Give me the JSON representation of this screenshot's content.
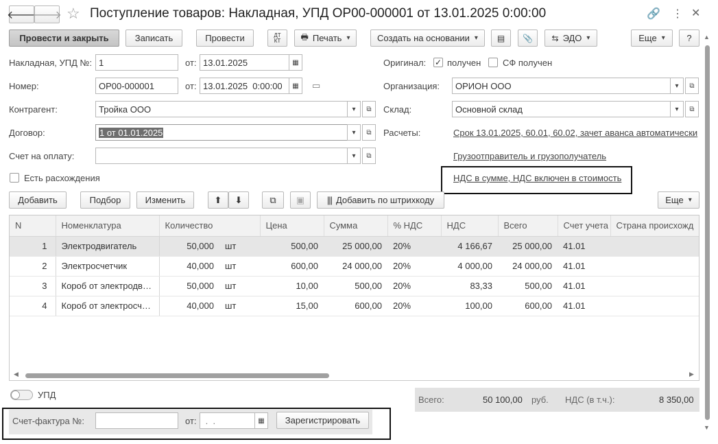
{
  "window": {
    "title": "Поступление товаров: Накладная, УПД ОР00-000001 от 13.01.2025 0:00:00"
  },
  "toolbar": {
    "post_close": "Провести и закрыть",
    "write": "Записать",
    "post": "Провести",
    "dt_kt_top": "ДТ",
    "dt_kt_bottom": "КТ",
    "print": "Печать",
    "create_based": "Создать на основании",
    "edo": "ЭДО",
    "more": "Еще",
    "help": "?"
  },
  "form": {
    "invoice_label": "Накладная, УПД №:",
    "invoice_no": "1",
    "from_label": "от:",
    "invoice_date": "13.01.2025",
    "number_label": "Номер:",
    "number_value": "ОР00-000001",
    "number_date": "13.01.2025  0:00:00",
    "contractor_label": "Контрагент:",
    "contractor_value": "Тройка ООО",
    "contract_label": "Договор:",
    "contract_value": "1 от 01.01.2025",
    "payment_label": "Счет на оплату:",
    "payment_value": "",
    "discrepancy_label": "Есть расхождения",
    "original_label": "Оригинал:",
    "received_label": "получен",
    "sf_received_label": "СФ получен",
    "org_label": "Организация:",
    "org_value": "ОРИОН ООО",
    "warehouse_label": "Склад:",
    "warehouse_value": "Основной склад",
    "settlements_label": "Расчеты:",
    "settlements_link": "Срок 13.01.2025, 60.01, 60.02, зачет аванса автоматически",
    "shipper_link": "Грузоотправитель и грузополучатель",
    "vat_link": "НДС в сумме, НДС включен в стоимость"
  },
  "table_toolbar": {
    "add": "Добавить",
    "pick": "Подбор",
    "change": "Изменить",
    "barcode": "Добавить по штрихкоду",
    "more": "Еще"
  },
  "table": {
    "columns": [
      "N",
      "Номенклатура",
      "Количество",
      "Цена",
      "Сумма",
      "% НДС",
      "НДС",
      "Всего",
      "Счет учета",
      "Страна происхожд"
    ],
    "rows": [
      {
        "n": "1",
        "name": "Электродвигатель",
        "qty": "50,000",
        "unit": "шт",
        "price": "500,00",
        "sum": "25 000,00",
        "rate": "20%",
        "vat": "4 166,67",
        "total": "25 000,00",
        "account": "41.01"
      },
      {
        "n": "2",
        "name": "Электросчетчик",
        "qty": "40,000",
        "unit": "шт",
        "price": "600,00",
        "sum": "24 000,00",
        "rate": "20%",
        "vat": "4 000,00",
        "total": "24 000,00",
        "account": "41.01"
      },
      {
        "n": "3",
        "name": "Короб от электродвигателя",
        "qty": "50,000",
        "unit": "шт",
        "price": "10,00",
        "sum": "500,00",
        "rate": "20%",
        "vat": "83,33",
        "total": "500,00",
        "account": "41.01"
      },
      {
        "n": "4",
        "name": "Короб от электросчетчика",
        "qty": "40,000",
        "unit": "шт",
        "price": "15,00",
        "sum": "600,00",
        "rate": "20%",
        "vat": "100,00",
        "total": "600,00",
        "account": "41.01"
      }
    ]
  },
  "footer": {
    "upd_label": "УПД",
    "total_label": "Всего:",
    "total_value": "50 100,00",
    "currency": "руб.",
    "vat_label": "НДС (в т.ч.):",
    "vat_value": "8 350,00",
    "invoice_label": "Счет-фактура №:",
    "invoice_from": "от:",
    "invoice_date_placeholder": " .  .",
    "register": "Зарегистрировать"
  },
  "icons": {
    "back": "arrow-left-icon",
    "forward": "arrow-right-icon",
    "favorite": "star-icon",
    "link": "link-icon",
    "menu": "vertical-dots-icon",
    "close": "close-icon"
  }
}
